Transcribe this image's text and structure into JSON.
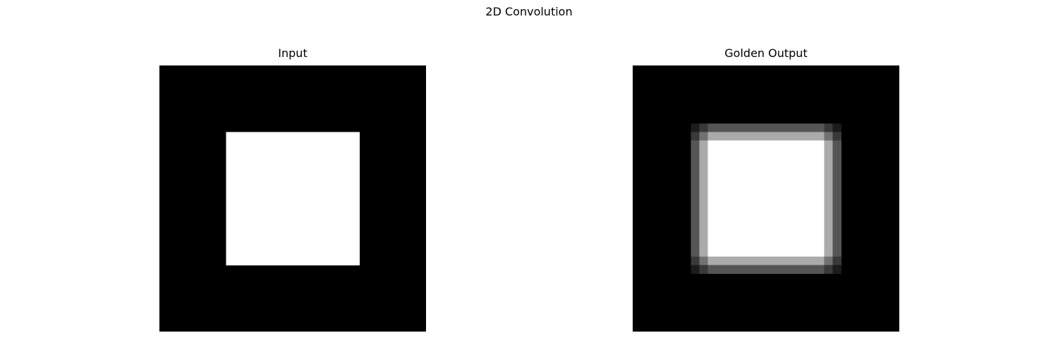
{
  "figure": {
    "title": "2D Convolution"
  },
  "chart_data": [
    {
      "type": "heatmap",
      "title": "Input",
      "colormap": "gray",
      "axes": "off",
      "grid_size": 32,
      "vmin": 0,
      "vmax": 1,
      "background_value": 0,
      "square": {
        "value": 1,
        "rows": [
          8,
          23
        ],
        "cols": [
          8,
          23
        ]
      }
    },
    {
      "type": "heatmap",
      "title": "Golden Output",
      "colormap": "gray",
      "axes": "off",
      "grid_size": 32,
      "vmin": 0,
      "vmax": 1,
      "background_value": 0,
      "square": {
        "value": 1,
        "rows": [
          8,
          23
        ],
        "cols": [
          8,
          23
        ]
      },
      "blur_kernel": 3
    }
  ]
}
